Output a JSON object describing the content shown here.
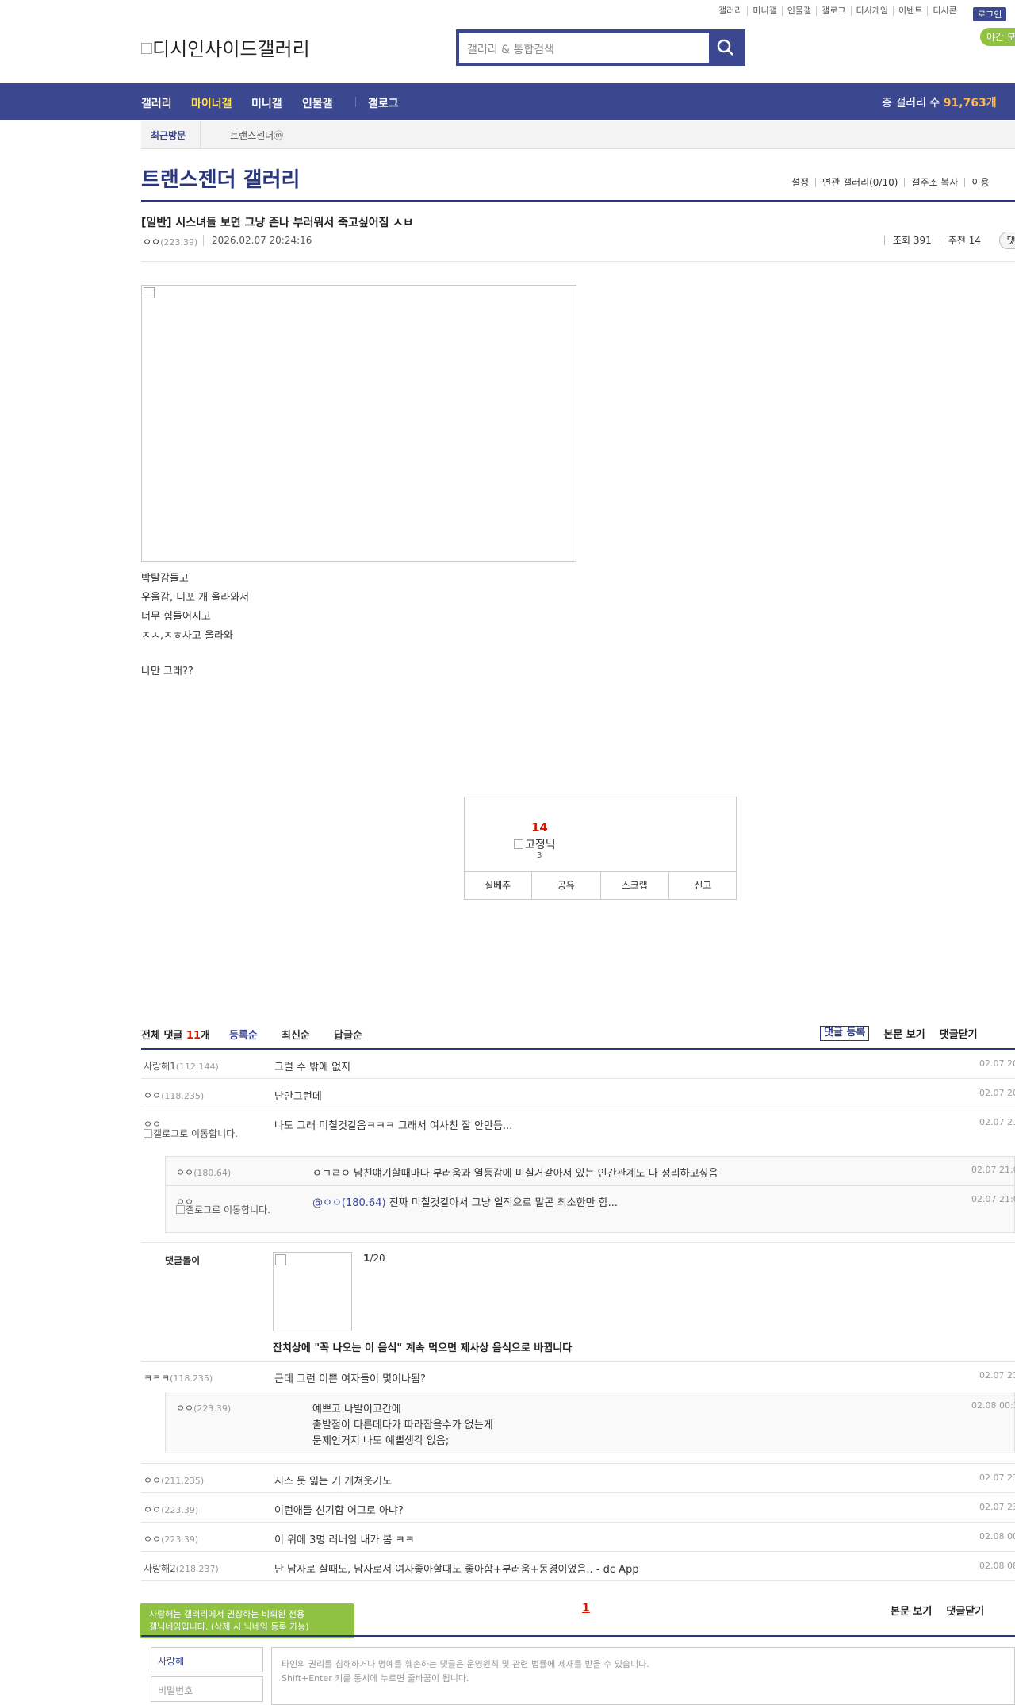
{
  "top_links": [
    "갤러리",
    "미니갤",
    "인물갤",
    "갤로그",
    "디시게임",
    "이벤트",
    "디시콘"
  ],
  "login_label": "로그인",
  "night_label": "야간 모드",
  "logo_text": "디시인사이드갤러리",
  "search": {
    "placeholder": "갤러리 & 통합검색"
  },
  "nav": {
    "items": [
      "갤러리",
      "마이너갤",
      "미니갤",
      "인물갤",
      "갤로그"
    ],
    "active": "마이너갤",
    "total_label": "총 갤러리 수",
    "total_value": "91,763개"
  },
  "visit": {
    "label": "최근방문",
    "gallery": "트랜스젠더ⓜ"
  },
  "gallery": {
    "title": "트랜스젠더 갤러리",
    "options": [
      "설정",
      "연관 갤러리(0/10)",
      "갤주소 복사",
      "이용"
    ]
  },
  "post": {
    "title": "[일반] 시스녀들 보면 그냥 존나 부러워서 죽고싶어짐 ㅅㅂ",
    "writer": "ㅇㅇ",
    "writer_ip": "(223.39)",
    "date": "2026.02.07 20:24:16",
    "views": "조회 391",
    "recommend": "추천 14",
    "badge": "댓",
    "body_lines": [
      "박탈감들고",
      "우울감, 디포 개 올라와서",
      "너무 힘들어지고",
      "ㅈㅅ,ㅈㅎ사고 올라와",
      "나만 그래??"
    ]
  },
  "recommend_box": {
    "count": "14",
    "fixed_label": "고정닉",
    "fixed_count": "3",
    "buttons": [
      "실베추",
      "공유",
      "스크랩",
      "신고"
    ]
  },
  "comments": {
    "total_prefix": "전체 댓글",
    "total_count": "11",
    "total_suffix": "개",
    "sorts": [
      "등록순",
      "최신순",
      "답글순"
    ],
    "options": [
      "댓글 등록",
      "본문 보기",
      "댓글닫기"
    ],
    "gallog_link": "갤로그로 이동합니다.",
    "rows": [
      {
        "writer": "사랑해1",
        "ip": "(112.144)",
        "text": "그럴 수 밖에 없지",
        "date": "02.07 20"
      },
      {
        "writer": "ㅇㅇ",
        "ip": "(118.235)",
        "text": "난안그런데",
        "date": "02.07 20"
      },
      {
        "writer": "ㅇㅇ",
        "ip": "",
        "text": "나도 그래 미칠것같음ㅋㅋㅋ 그래서 여사친 잘 안만듬...",
        "date": "02.07 21"
      },
      {
        "writer": "ㅇㅇ",
        "ip": "(180.64)",
        "text": "ㅇㄱㄹㅇ 남친얘기할때마다 부러움과 열등감에 미칠거같아서 있는 인간관계도 다 정리하고싶음",
        "date": "02.07 21:0"
      },
      {
        "writer": "ㅇㅇ",
        "ip": "",
        "mention": "@ㅇㅇ(180.64)",
        "text": " 진짜 미칠것같아서 그냥 일적으로 말곤 최소한만 함...",
        "date": "02.07 21:0"
      },
      {
        "writer": "ㅋㅋㅋ",
        "ip": "(118.235)",
        "text": "근데 그런 이쁜 여자들이 몇이나됨?",
        "date": "02.07 21"
      },
      {
        "writer": "ㅇㅇ",
        "ip": "(223.39)",
        "lines": [
          "예쁘고 나발이고간에",
          "출발점이 다른데다가 따라잡을수가 없는게",
          "문제인거지 나도 예뻘생각 없음;"
        ],
        "date": "02.08 00:3"
      },
      {
        "writer": "ㅇㅇ",
        "ip": "(211.235)",
        "text": "시스 못 잃는 거 개쳐웃기노",
        "date": "02.07 23"
      },
      {
        "writer": "ㅇㅇ",
        "ip": "(223.39)",
        "text": "이런애들 신기함 어그로 아냐?",
        "date": "02.07 23"
      },
      {
        "writer": "ㅇㅇ",
        "ip": "(223.39)",
        "text": "이 위에 3명 러버임 내가 봄 ㅋㅋ",
        "date": "02.08 00"
      },
      {
        "writer": "사랑해2",
        "ip": "(218.237)",
        "text": "난 남자로 살때도, 남자로서 여자좋아할때도 좋아함+부러움+동경이었음.. - dc App",
        "date": "02.08 08"
      }
    ],
    "dory": {
      "name": "댓글돌이",
      "page_current": "1",
      "page_total": "/20",
      "title": "잔치상에 \"꼭 나오는 이 음식\" 계속 먹으면 제사상 음식으로 바뀝니다"
    }
  },
  "bottom": {
    "tip_line1": "사랑해는 갤러리에서 권장하는 비회원 전용",
    "tip_line2": "갤닉네임입니다. (삭제 시 닉네임 등록 가능)",
    "page": "1",
    "options": [
      "본문 보기",
      "댓글닫기"
    ],
    "nickname": "사랑해",
    "password_placeholder": "비밀번호",
    "notice_line1": "타인의 권리를 침해하거나 명예를 훼손하는 댓글은 운영원칙 및 관련 법률에 제재를 받을 수 있습니다.",
    "notice_line2": "Shift+Enter 키를 동시에 누르면 줄바꿈이 됩니다."
  },
  "colors": {
    "brand": "#3b4890",
    "title": "#29367c",
    "accent": "#d31900",
    "highlight": "#ffb84d",
    "night": "#8fc241"
  }
}
